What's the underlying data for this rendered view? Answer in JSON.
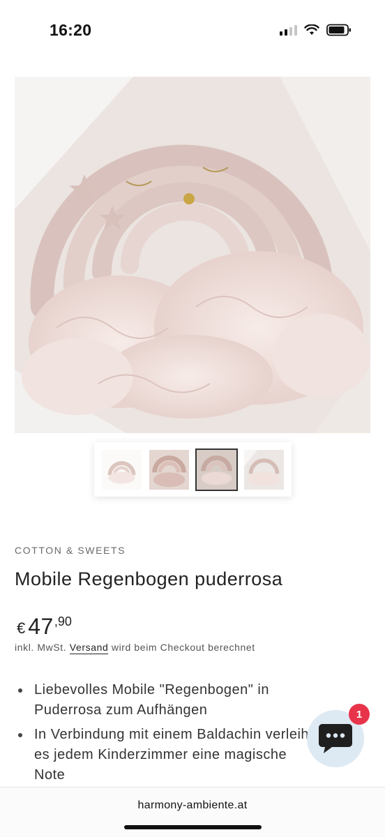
{
  "status_bar": {
    "time": "16:20"
  },
  "gallery": {
    "main_image_alt": "Mobile Regenbogen puderrosa",
    "thumbnails": [
      {
        "name": "thumb-1",
        "active": false
      },
      {
        "name": "thumb-2",
        "active": false
      },
      {
        "name": "thumb-3",
        "active": true
      },
      {
        "name": "thumb-4",
        "active": false
      }
    ]
  },
  "product": {
    "brand": "COTTON & SWEETS",
    "title": "Mobile Regenbogen puderrosa",
    "price": {
      "currency": "€",
      "integer": "47",
      "decimal": ",90"
    },
    "tax_note": {
      "prefix": "inkl. MwSt.",
      "link": "Versand",
      "suffix": "wird beim Checkout berechnet"
    },
    "features": [
      "Liebevolles Mobile \"Regenbogen\" in Puderrosa zum Aufhängen",
      "In Verbindung mit einem Baldachin verleiht es jedem Kinderzimmer eine magische Note"
    ]
  },
  "chat": {
    "badge_count": "1",
    "icon": "chat-bubble-icon",
    "color": "#dde9f3",
    "badge_color": "#e8344a"
  },
  "browser": {
    "url": "harmony-ambiente.at"
  }
}
